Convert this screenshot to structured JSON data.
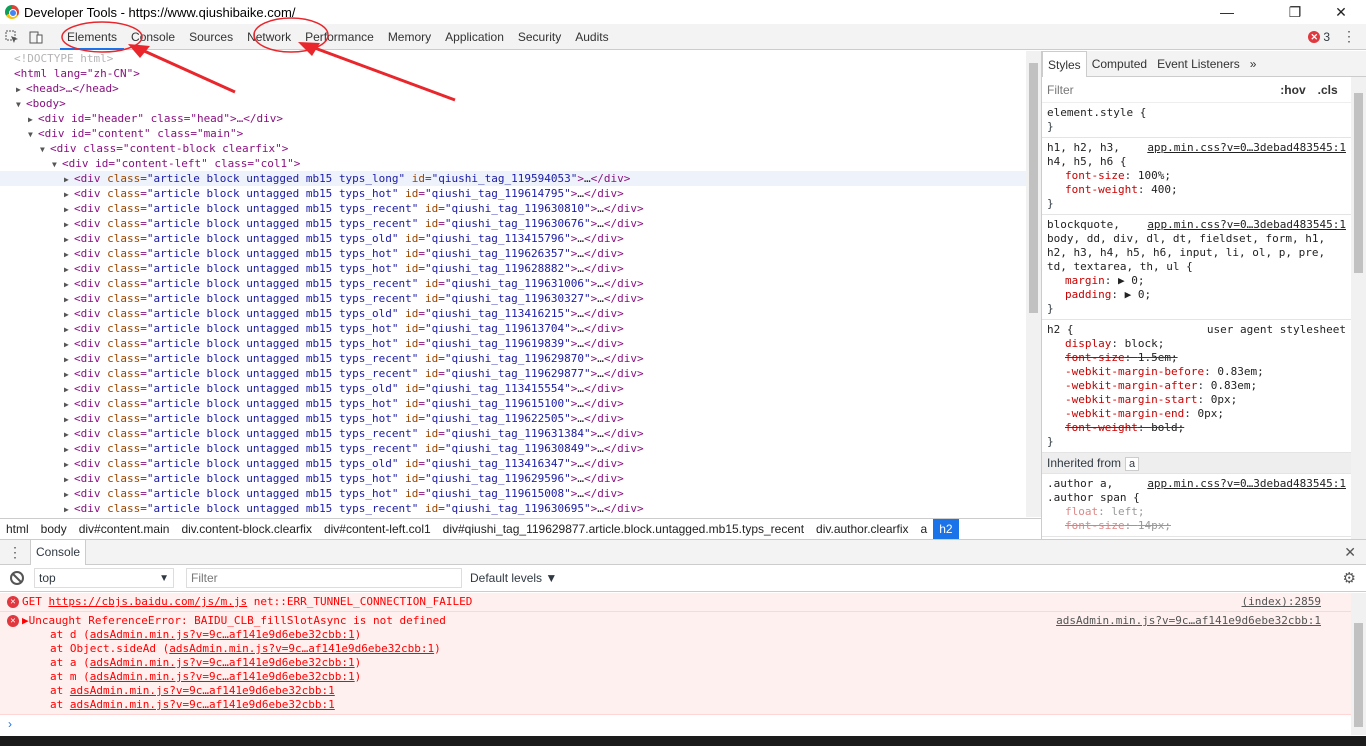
{
  "window": {
    "title": "Developer Tools - https://www.qiushibaike.com/"
  },
  "tabs": [
    "Elements",
    "Console",
    "Sources",
    "Network",
    "Performance",
    "Memory",
    "Application",
    "Security",
    "Audits"
  ],
  "error_count": "3",
  "dom": {
    "head": [
      {
        "kind": "comment",
        "text": "<!DOCTYPE html>",
        "indent": 0,
        "tri": ""
      },
      {
        "kind": "open",
        "text": "<html lang=\"zh-CN\">",
        "indent": 0,
        "tri": ""
      },
      {
        "kind": "collapsed",
        "text": "<head>…</head>",
        "indent": 1,
        "tri": "▶"
      },
      {
        "kind": "open",
        "text": "<body>",
        "indent": 1,
        "tri": "▼"
      },
      {
        "kind": "collapsed",
        "text": "<div id=\"header\" class=\"head\">…</div>",
        "indent": 2,
        "tri": "▶"
      },
      {
        "kind": "open",
        "text": "<div id=\"content\" class=\"main\">",
        "indent": 2,
        "tri": "▼"
      },
      {
        "kind": "open",
        "text": "<div class=\"content-block clearfix\">",
        "indent": 3,
        "tri": "▼"
      },
      {
        "kind": "open",
        "text": "<div id=\"content-left\" class=\"col1\">",
        "indent": 4,
        "tri": "▼"
      }
    ],
    "articles": [
      [
        "typs_long",
        "qiushi_tag_119594053"
      ],
      [
        "typs_hot",
        "qiushi_tag_119614795"
      ],
      [
        "typs_recent",
        "qiushi_tag_119630810"
      ],
      [
        "typs_recent",
        "qiushi_tag_119630676"
      ],
      [
        "typs_old",
        "qiushi_tag_113415796"
      ],
      [
        "typs_hot",
        "qiushi_tag_119626357"
      ],
      [
        "typs_hot",
        "qiushi_tag_119628882"
      ],
      [
        "typs_recent",
        "qiushi_tag_119631006"
      ],
      [
        "typs_recent",
        "qiushi_tag_119630327"
      ],
      [
        "typs_old",
        "qiushi_tag_113416215"
      ],
      [
        "typs_hot",
        "qiushi_tag_119613704"
      ],
      [
        "typs_hot",
        "qiushi_tag_119619839"
      ],
      [
        "typs_recent",
        "qiushi_tag_119629870"
      ],
      [
        "typs_recent",
        "qiushi_tag_119629877"
      ],
      [
        "typs_old",
        "qiushi_tag_113415554"
      ],
      [
        "typs_hot",
        "qiushi_tag_119615100"
      ],
      [
        "typs_hot",
        "qiushi_tag_119622505"
      ],
      [
        "typs_recent",
        "qiushi_tag_119631384"
      ],
      [
        "typs_recent",
        "qiushi_tag_119630849"
      ],
      [
        "typs_old",
        "qiushi_tag_113416347"
      ],
      [
        "typs_hot",
        "qiushi_tag_119629596"
      ],
      [
        "typs_hot",
        "qiushi_tag_119615008"
      ],
      [
        "typs_recent",
        "qiushi_tag_119630695"
      ]
    ],
    "article_class_prefix": "article block untagged mb15 "
  },
  "breadcrumbs": [
    "html",
    "body",
    "div#content.main",
    "div.content-block.clearfix",
    "div#content-left.col1",
    "div#qiushi_tag_119629877.article.block.untagged.mb15.typs_recent",
    "div.author.clearfix",
    "a",
    "h2"
  ],
  "sidebar": {
    "tabs": [
      "Styles",
      "Computed",
      "Event Listeners"
    ],
    "more": "»",
    "filter_placeholder": "Filter",
    "hov": ":hov",
    "cls": ".cls",
    "plus": "+",
    "rules": [
      {
        "selector": "element.style {",
        "source": "",
        "props": [],
        "close": "}"
      },
      {
        "selector": "h1, h2, h3,\nh4, h5, h6 {",
        "source": "app.min.css?v=0…3debad483545:1",
        "props": [
          [
            "font-size",
            "100%;",
            false
          ],
          [
            "font-weight",
            "400;",
            false
          ]
        ],
        "close": "}"
      },
      {
        "selector": "blockquote,\nbody, dd, div, dl, dt, fieldset, form, h1,\nh2, h3, h4, h5, h6, input, li, ol, p, pre,\ntd, textarea, th, ul {",
        "source": "app.min.css?v=0…3debad483545:1",
        "props": [
          [
            "margin",
            "▶ 0;",
            false
          ],
          [
            "padding",
            "▶ 0;",
            false
          ]
        ],
        "close": "}"
      },
      {
        "selector": "h2 {",
        "ua": "user agent stylesheet",
        "props": [
          [
            "display",
            "block;",
            false
          ],
          [
            "font-size",
            "1.5em;",
            true
          ],
          [
            "-webkit-margin-before",
            "0.83em;",
            false
          ],
          [
            "-webkit-margin-after",
            "0.83em;",
            false
          ],
          [
            "-webkit-margin-start",
            "0px;",
            false
          ],
          [
            "-webkit-margin-end",
            "0px;",
            false
          ],
          [
            "font-weight",
            "bold;",
            true
          ]
        ],
        "close": "}"
      }
    ],
    "inherited_label": "Inherited from",
    "inherited_tag": "a",
    "author_rule": {
      "selector": ".author a,\n.author span {",
      "source": "app.min.css?v=0…3debad483545:1",
      "props": [
        [
          "float",
          "left;",
          false
        ],
        [
          "font-size",
          "14px;",
          true
        ]
      ]
    }
  },
  "drawer": {
    "menu": "⋮",
    "tab": "Console",
    "close": "✕"
  },
  "console_toolbar": {
    "context": "top",
    "filter_placeholder": "Filter",
    "levels": "Default levels ▼"
  },
  "messages": {
    "m1": {
      "method": "GET ",
      "url": "https://cbjs.baidu.com/js/m.js",
      "text": " net::ERR_TUNNEL_CONNECTION_FAILED",
      "loc": "(index):2859"
    },
    "m2": {
      "text": "▶Uncaught ReferenceError: BAIDU_CLB_fillSlotAsync is not defined",
      "loc": "adsAdmin.min.js?v=9c…af141e9d6ebe32cbb:1",
      "stack": [
        [
          "at d (",
          "adsAdmin.min.js?v=9c…af141e9d6ebe32cbb:1",
          ")"
        ],
        [
          "at Object.sideAd (",
          "adsAdmin.min.js?v=9c…af141e9d6ebe32cbb:1",
          ")"
        ],
        [
          "at a (",
          "adsAdmin.min.js?v=9c…af141e9d6ebe32cbb:1",
          ")"
        ],
        [
          "at m (",
          "adsAdmin.min.js?v=9c…af141e9d6ebe32cbb:1",
          ")"
        ],
        [
          "at ",
          "adsAdmin.min.js?v=9c…af141e9d6ebe32cbb:1",
          ""
        ],
        [
          "at ",
          "adsAdmin.min.js?v=9c…af141e9d6ebe32cbb:1",
          ""
        ]
      ]
    }
  },
  "prompt": "›",
  "colors": {
    "accent": "#1a73e8",
    "error": "#ff0000",
    "annotation": "#e8262c"
  }
}
